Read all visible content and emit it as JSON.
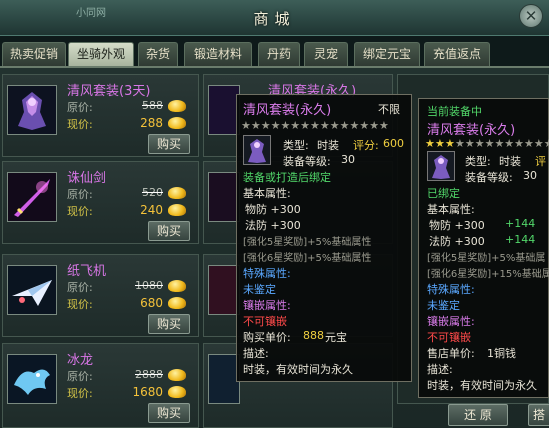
{
  "window": {
    "title": "商城",
    "watermark": "小同网"
  },
  "tabs": [
    {
      "label": "热卖促销",
      "active": false
    },
    {
      "label": "坐骑外观",
      "active": true
    },
    {
      "label": "杂货",
      "active": false
    },
    {
      "label": "锻造材料",
      "active": false
    },
    {
      "label": "丹药",
      "active": false
    },
    {
      "label": "灵宠",
      "active": false
    },
    {
      "label": "绑定元宝",
      "active": false
    },
    {
      "label": "充值返点",
      "active": false
    }
  ],
  "items": [
    {
      "name": "清风套装(3天)",
      "orig_label": "原价:",
      "cur_label": "现价:",
      "orig_price": "588",
      "cur_price": "288",
      "buy": "购买"
    },
    {
      "name": "诛仙剑",
      "orig_label": "原价:",
      "cur_label": "现价:",
      "orig_price": "520",
      "cur_price": "240",
      "buy": "购买"
    },
    {
      "name": "纸飞机",
      "orig_label": "原价:",
      "cur_label": "现价:",
      "orig_price": "1080",
      "cur_price": "680",
      "buy": "购买"
    },
    {
      "name": "冰龙",
      "orig_label": "原价:",
      "cur_label": "现价:",
      "orig_price": "2888",
      "cur_price": "1680",
      "buy": "购买"
    }
  ],
  "col2": {
    "name": "清风套装(永久)"
  },
  "tooltip_shop": {
    "name": "清风套装(永久)",
    "unlimited": "不限",
    "type_label": "类型:",
    "type_value": "时装",
    "score_label": "评分:",
    "score_value": "600",
    "level_label": "装备等级:",
    "level_value": "30",
    "bind_note": "装备或打造后绑定",
    "base_attr_title": "基本属性:",
    "wufang": "物防  +300",
    "fafang": "法防  +300",
    "bonus5": "[强化5星奖励]+5%基础属性",
    "bonus6": "[强化6星奖励]+5%基础属性",
    "special": "特殊属性:",
    "unidentified": "未鉴定",
    "inlay": "镶嵌属性:",
    "cannot_inlay": "不可镶嵌",
    "buy_price_label": "购买单价:",
    "buy_price_value": "888",
    "buy_price_unit": "元宝",
    "desc_label": "描述:",
    "desc": "时装，有效时间为永久",
    "stars_filled": 0,
    "stars_total": 15
  },
  "tooltip_equipped": {
    "header": "当前装备中",
    "name": "清风套装(永久)",
    "type_label": "类型:",
    "type_value": "时装",
    "score_label": "评",
    "level_label": "装备等级:",
    "level_value": "30",
    "bound": "已绑定",
    "base_attr_title": "基本属性:",
    "wufang": "物防  +300",
    "wufang_bonus": "+144",
    "fafang": "法防  +300",
    "fafang_bonus": "+144",
    "bonus5": "[强化5星奖励]+5%基础属",
    "bonus6": "[强化6星奖励]+15%基础属",
    "special": "特殊属性:",
    "unidentified": "未鉴定",
    "inlay": "镶嵌属性:",
    "cannot_inlay": "不可镶嵌",
    "sell_price_label": "售店单价:",
    "sell_price_value": "1铜钱",
    "desc_label": "描述:",
    "desc": "时装，有效时间为永久",
    "stars_filled": 3,
    "stars_total": 13
  },
  "buttons": {
    "restore": "还 原",
    "right_partial": "搭"
  },
  "colors": {
    "name_purple": "#d876e6",
    "gold": "#f4c23a",
    "green": "#52d86a"
  }
}
